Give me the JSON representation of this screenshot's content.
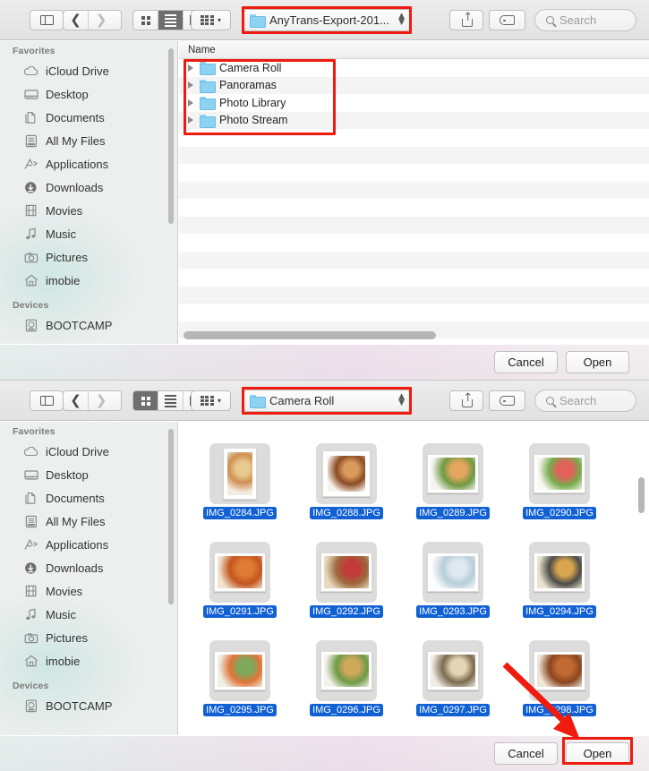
{
  "windows": [
    {
      "id": "open-dialog-parent",
      "view_mode": "list",
      "path_label": "AnyTrans-Export-201...",
      "search_placeholder": "Search",
      "toolbar": {
        "sidebar_toggle": "sidebar-toggle",
        "back": "‹",
        "forward": "›",
        "view_icon": "icon-view",
        "view_list": "list-view",
        "view_column": "column-view",
        "arrange": "arrange",
        "share": "share",
        "tags": "tags"
      },
      "column_header": "Name",
      "rows": [
        {
          "name": "Camera Roll"
        },
        {
          "name": "Panoramas"
        },
        {
          "name": "Photo Library"
        },
        {
          "name": "Photo Stream"
        }
      ],
      "buttons": {
        "cancel": "Cancel",
        "open": "Open"
      }
    },
    {
      "id": "open-dialog-camera-roll",
      "view_mode": "icon",
      "path_label": "Camera Roll",
      "search_placeholder": "Search",
      "files": [
        {
          "name": "IMG_0284.JPG",
          "selected": true,
          "orient": "portrait",
          "c1": "#e8c98f",
          "c2": "#cf8f52",
          "c3": "#f3ece0"
        },
        {
          "name": "IMG_0288.JPG",
          "selected": true,
          "orient": "square",
          "c1": "#d99a5c",
          "c2": "#8c4a22",
          "c3": "#f7f2ea"
        },
        {
          "name": "IMG_0289.JPG",
          "selected": true,
          "orient": "landscape",
          "c1": "#e5a55f",
          "c2": "#6e9a41",
          "c3": "#f6f4f0"
        },
        {
          "name": "IMG_0290.JPG",
          "selected": true,
          "orient": "landscape",
          "c1": "#e0625a",
          "c2": "#76ab4d",
          "c3": "#faf7f3"
        },
        {
          "name": "IMG_0291.JPG",
          "selected": true,
          "orient": "landscape",
          "c1": "#e07b33",
          "c2": "#c4541f",
          "c3": "#f0e3cf"
        },
        {
          "name": "IMG_0292.JPG",
          "selected": true,
          "orient": "landscape",
          "c1": "#c33b3b",
          "c2": "#9a6a3c",
          "c3": "#e9d9be"
        },
        {
          "name": "IMG_0293.JPG",
          "selected": true,
          "orient": "landscape",
          "c1": "#dfe9ef",
          "c2": "#b7cdd8",
          "c3": "#fbfcfd"
        },
        {
          "name": "IMG_0294.JPG",
          "selected": true,
          "orient": "landscape",
          "c1": "#d9a64e",
          "c2": "#4c4b48",
          "c3": "#ece3cf"
        },
        {
          "name": "IMG_0295.JPG",
          "selected": true,
          "orient": "landscape",
          "c1": "#7ea85a",
          "c2": "#e2743a",
          "c3": "#eef0e6"
        },
        {
          "name": "IMG_0296.JPG",
          "selected": true,
          "orient": "landscape",
          "c1": "#cfa85c",
          "c2": "#6d9a45",
          "c3": "#f4f2ec"
        },
        {
          "name": "IMG_0297.JPG",
          "selected": true,
          "orient": "landscape",
          "c1": "#e3d6b6",
          "c2": "#7b6a4e",
          "c3": "#efece4"
        },
        {
          "name": "IMG_0298.JPG",
          "selected": true,
          "orient": "landscape",
          "c1": "#c26a33",
          "c2": "#8a4520",
          "c3": "#efe6da"
        }
      ],
      "buttons": {
        "cancel": "Cancel",
        "open": "Open"
      }
    }
  ],
  "sidebar": {
    "sections": [
      {
        "title": "Favorites",
        "items": [
          {
            "label": "iCloud Drive",
            "icon": "cloud-icon"
          },
          {
            "label": "Desktop",
            "icon": "desktop-icon"
          },
          {
            "label": "Documents",
            "icon": "documents-icon"
          },
          {
            "label": "All My Files",
            "icon": "all-my-files-icon"
          },
          {
            "label": "Applications",
            "icon": "applications-icon"
          },
          {
            "label": "Downloads",
            "icon": "downloads-icon"
          },
          {
            "label": "Movies",
            "icon": "movies-icon"
          },
          {
            "label": "Music",
            "icon": "music-icon"
          },
          {
            "label": "Pictures",
            "icon": "pictures-icon"
          },
          {
            "label": "imobie",
            "icon": "home-icon"
          }
        ]
      },
      {
        "title": "Devices",
        "items": [
          {
            "label": "BOOTCAMP",
            "icon": "disk-icon"
          }
        ]
      }
    ]
  },
  "annotations": {
    "highlight_color": "#ee1b0e",
    "boxes": [
      "path-popup-window-1",
      "folder-list-window-1",
      "path-popup-window-2",
      "open-button-window-2"
    ],
    "arrow": "red-arrow-pointing-to-open-button"
  },
  "colors": {
    "selection_blue": "#1161d5",
    "toolbar_gray": "#e8e8e8",
    "sidebar_gray": "#edeeee"
  }
}
